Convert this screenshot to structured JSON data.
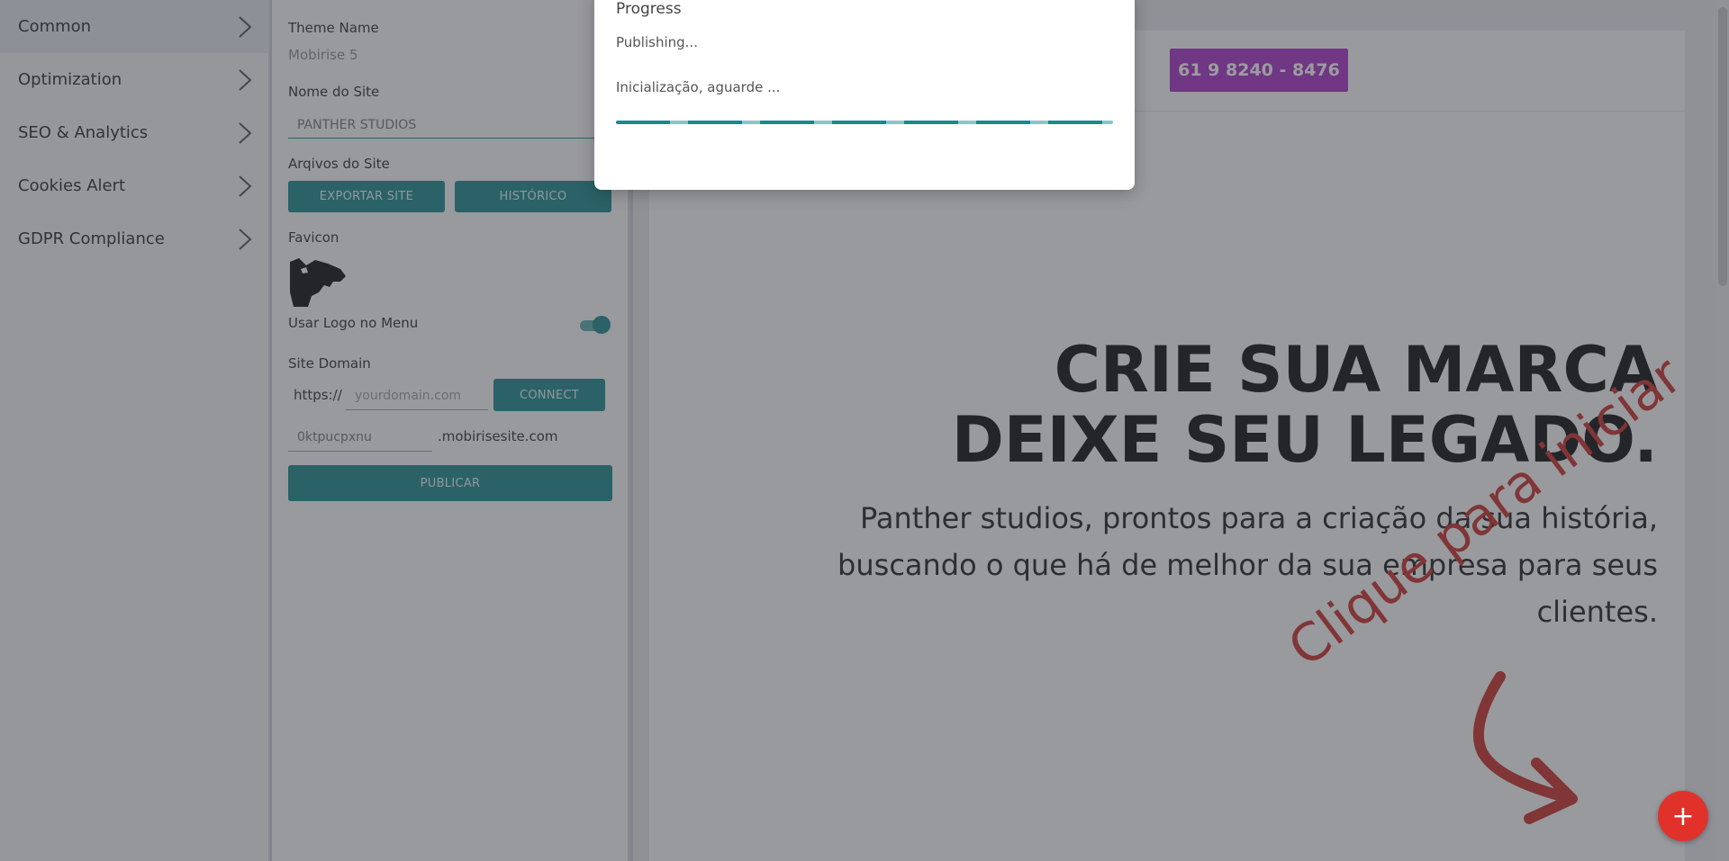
{
  "menu": {
    "items": [
      {
        "label": "Common",
        "active": true
      },
      {
        "label": "Optimization",
        "active": false
      },
      {
        "label": "SEO & Analytics",
        "active": false
      },
      {
        "label": "Cookies Alert",
        "active": false
      },
      {
        "label": "GDPR Compliance",
        "active": false
      }
    ]
  },
  "panel": {
    "theme_name_label": "Theme Name",
    "theme_name_value": "Mobirise 5",
    "site_name_label": "Nome do Site",
    "site_name_value": "PANTHER STUDIOS",
    "site_files_label": "Arqivos do Site",
    "export_button": "EXPORTAR SITE",
    "history_button": "HISTÓRICO",
    "favicon_label": "Favicon",
    "use_logo_label": "Usar Logo no Menu",
    "use_logo_enabled": true,
    "site_domain_label": "Site Domain",
    "domain_prefix": "https://",
    "domain_placeholder": "yourdomain.com",
    "connect_button": "CONNECT",
    "subdomain_value": "0ktpucpxnu",
    "subdomain_suffix": ".mobirisesite.com",
    "publish_button": "PUBLICAR"
  },
  "preview": {
    "phone_button": "61 9 8240 - 8476",
    "hero_line1": "CRIE SUA MARCA",
    "hero_line2": "DEIXE SEU LEGADO.",
    "hero_text_line1": "Panther studios, prontos para a criação da sua história,",
    "hero_text_line2": "buscando o que há de melhor da sua empresa para seus clientes.",
    "hint": "Clique para iniciar",
    "fab_label": "+"
  },
  "modal": {
    "title": "Progress",
    "status": "Publishing...",
    "detail": "Inicialização, aguarde ..."
  },
  "colors": {
    "accent": "#1d8a8f",
    "phone_button": "#a734c9",
    "hint": "#c8312f",
    "fab": "#e0322b"
  }
}
